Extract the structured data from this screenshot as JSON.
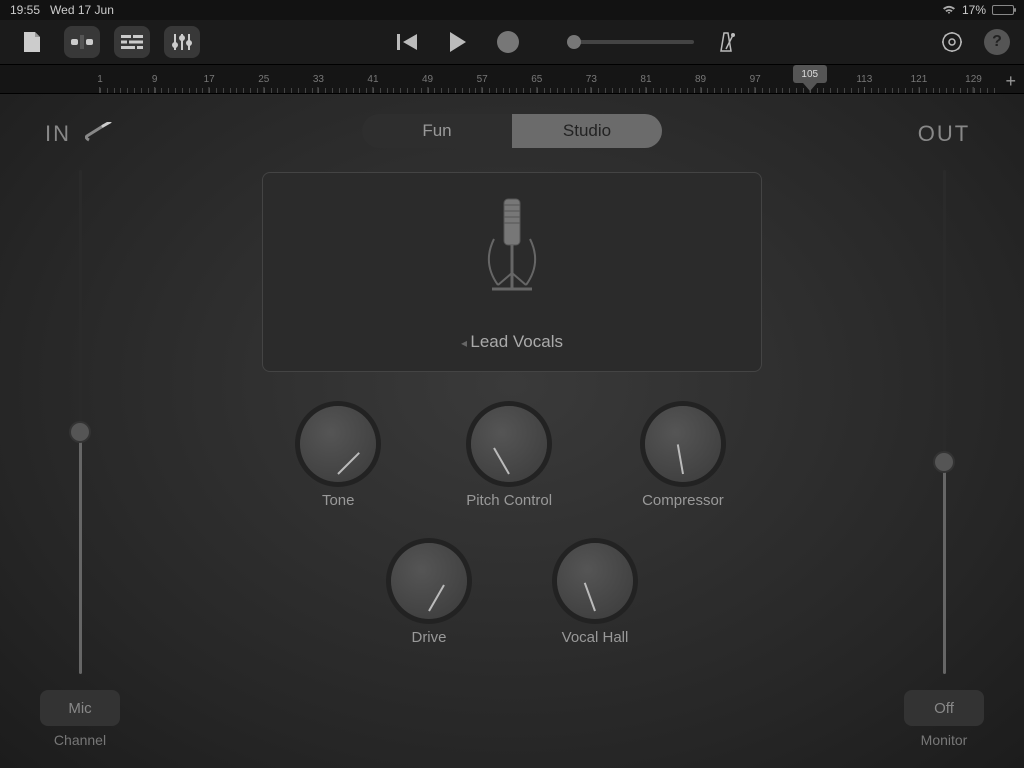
{
  "status": {
    "time": "19:55",
    "date": "Wed 17 Jun",
    "battery_pct": "17%",
    "battery_fill": 17
  },
  "ruler": {
    "playhead": 105,
    "ticks": [
      1,
      9,
      17,
      25,
      33,
      41,
      49,
      57,
      65,
      73,
      81,
      89,
      97,
      105,
      113,
      121,
      129
    ],
    "range_start": 1,
    "range_end": 132
  },
  "segmented": {
    "fun": "Fun",
    "studio": "Studio",
    "active": "studio"
  },
  "preset": {
    "name": "Lead Vocals"
  },
  "knobs": [
    {
      "label": "Tone",
      "angle": 45
    },
    {
      "label": "Pitch Control",
      "angle": -30
    },
    {
      "label": "Compressor",
      "angle": -10
    },
    {
      "label": "Drive",
      "angle": 30
    },
    {
      "label": "Vocal Hall",
      "angle": -20
    }
  ],
  "side": {
    "in_label": "IN",
    "out_label": "OUT",
    "in_value": 48,
    "out_value": 42,
    "mic_btn": "Mic",
    "channel_lbl": "Channel",
    "off_btn": "Off",
    "monitor_lbl": "Monitor"
  }
}
